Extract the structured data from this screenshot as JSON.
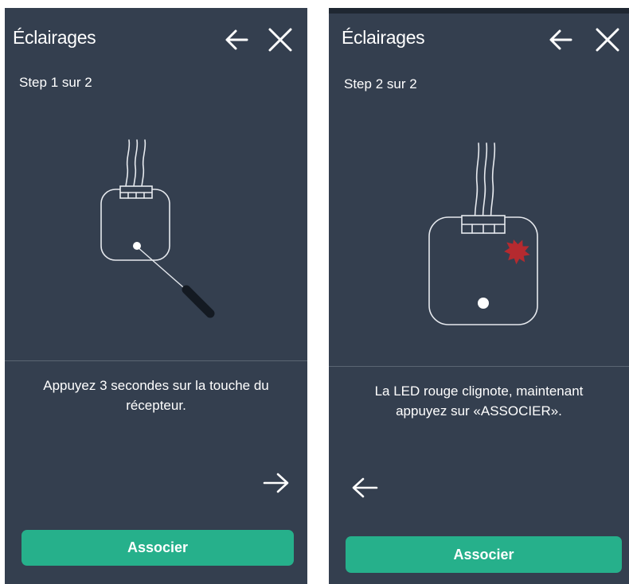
{
  "colors": {
    "panel_bg": "#343f4f",
    "accent": "#26b08b",
    "led_red": "#b52a2f",
    "text": "#ffffff"
  },
  "screens": [
    {
      "title": "Éclairages",
      "step": "Step 1 sur 2",
      "instruction": "Appuyez 3 secondes sur la touche du récepteur.",
      "button_label": "Associer",
      "icons": [
        "back-arrow-icon",
        "close-icon",
        "next-arrow-icon"
      ]
    },
    {
      "title": "Éclairages",
      "step": "Step 2 sur 2",
      "instruction": "La LED rouge clignote, maintenant appuyez sur «ASSOCIER».",
      "button_label": "Associer",
      "icons": [
        "back-arrow-icon",
        "close-icon",
        "previous-arrow-icon"
      ]
    }
  ]
}
